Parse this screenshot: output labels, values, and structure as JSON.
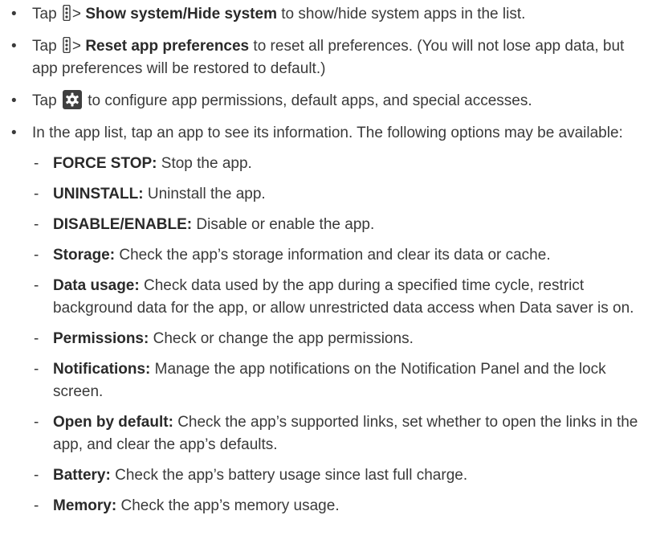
{
  "bullets": {
    "show_system": {
      "prefix": "Tap",
      "sep": ">",
      "bold": "Show system/Hide system",
      "rest": "to show/hide system apps in the list."
    },
    "reset_prefs": {
      "prefix": "Tap",
      "sep": ">",
      "bold": "Reset app preferences",
      "rest": "to reset all preferences. (You will not lose app data, but app preferences will be restored to default.)"
    },
    "configure": {
      "prefix": "Tap",
      "rest": "to configure app permissions, default apps, and special accesses."
    },
    "app_list": {
      "text": "In the app list, tap an app to see its information. The following options may be available:"
    }
  },
  "options": [
    {
      "term": "FORCE STOP:",
      "desc": "Stop the app."
    },
    {
      "term": "UNINSTALL:",
      "desc": "Uninstall the app."
    },
    {
      "term": "DISABLE/ENABLE:",
      "desc": "Disable or enable the app."
    },
    {
      "term": "Storage:",
      "desc": "Check the app’s storage information and clear its data or cache."
    },
    {
      "term": "Data usage:",
      "desc": "Check data used by the app during a specified time cycle, restrict background data for the app, or allow unrestricted data access when Data saver is on."
    },
    {
      "term": "Permissions:",
      "desc": "Check or change the app permissions."
    },
    {
      "term": "Notifications:",
      "desc": "Manage the app notifications on the Notification Panel and the lock screen."
    },
    {
      "term": "Open by default:",
      "desc": "Check the app’s supported links, set whether to open the links in the app, and clear the app’s defaults."
    },
    {
      "term": "Battery:",
      "desc": "Check the app’s battery usage since last full charge."
    },
    {
      "term": "Memory:",
      "desc": "Check the app’s memory usage."
    }
  ]
}
